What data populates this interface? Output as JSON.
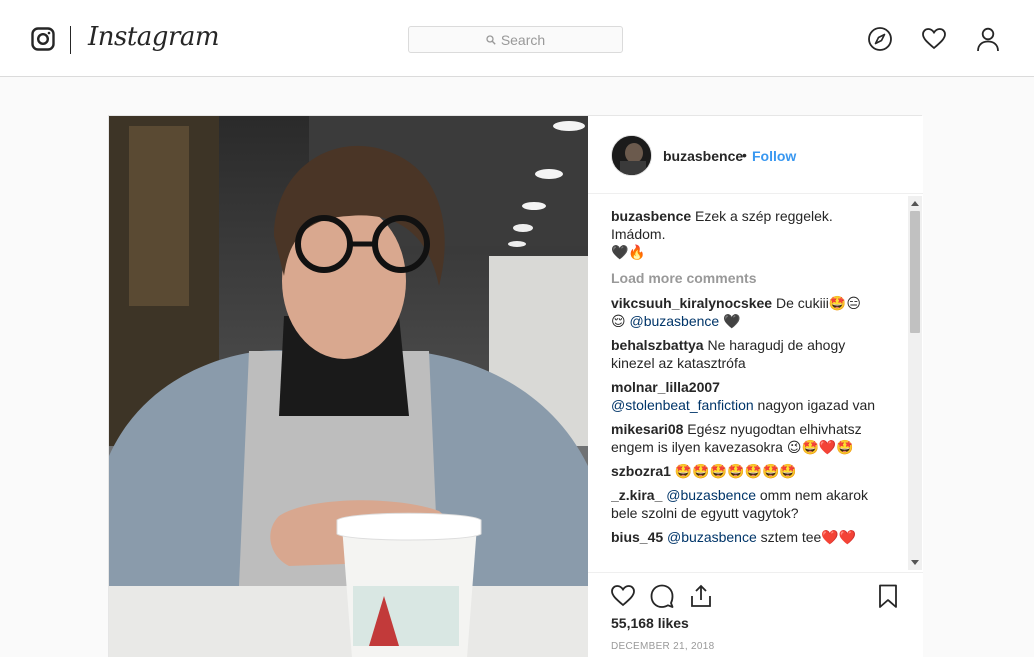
{
  "nav": {
    "wordmark": "Instagram",
    "search_placeholder": "Search"
  },
  "post": {
    "author": "buzasbence",
    "separator": "•",
    "follow_label": "Follow",
    "caption_user": "buzasbence",
    "caption_text": "Ezek a szép reggelek. Imádom.",
    "caption_emoji": "🖤🔥",
    "load_more": "Load more comments",
    "comments": [
      {
        "user": "vikcsuuh_kiralynocskee",
        "pre": "De cukiii🤩😑",
        "line2_pre": "😌 ",
        "mention": "@buzasbence",
        "post": " 🖤"
      },
      {
        "user": "behalszbattya",
        "text": "Ne haragudj de ahogy kinezel az katasztrófa"
      },
      {
        "user": "molnar_lilla2007",
        "mention": "@stolenbeat_fanfiction",
        "post": " nagyon igazad van"
      },
      {
        "user": "mikesari08",
        "text": "Egész nyugodtan elhivhatsz engem is ilyen kavezasokra 😉🤩❤️🤩"
      },
      {
        "user": "szbozra1",
        "text": "🤩🤩🤩🤩🤩🤩🤩"
      },
      {
        "user": "_z.kira_",
        "mention": "@buzasbence",
        "post": " omm nem akarok bele szolni de egyutt vagytok?"
      },
      {
        "user": "bius_45",
        "mention": "@buzasbence",
        "post": " sztem tee❤️❤️"
      }
    ],
    "likes": "55,168 likes",
    "date": "DECEMBER 21, 2018"
  },
  "icons": [
    "instagram-glyph-icon",
    "search-icon",
    "compass-icon",
    "heart-icon",
    "profile-icon",
    "like-icon",
    "comment-icon",
    "share-icon",
    "bookmark-icon"
  ],
  "colors": {
    "link": "#3897f0",
    "mention": "#003569",
    "muted": "#999999",
    "border": "#dbdbdb"
  }
}
